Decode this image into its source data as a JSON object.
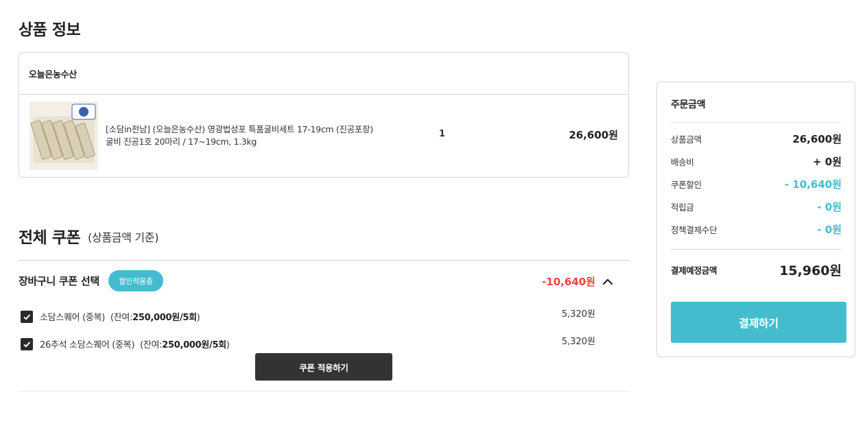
{
  "product_section": {
    "title": "상품 정보",
    "seller": "오늘은농수산",
    "item": {
      "name_line1": "[소담in전남] (오늘은농수산) 영광법성포 특품굴비세트 17-19cm (진공포장)",
      "name_line2": "굴비 진공1호 20마리 / 17~19cm, 1.3kg",
      "quantity": "1",
      "price": "26,600원"
    }
  },
  "coupon_section": {
    "title": "전체 쿠폰",
    "basis": "(상품금액 기준)",
    "cart_coupon_label": "장바구니 쿠폰 선택",
    "applied_badge": "할인적용중",
    "total_discount": "-10,640원",
    "coupons": [
      {
        "name": "소담스퀘어 (중복)",
        "remain_prefix": "(잔여:",
        "remain_value": "250,000원/5회",
        "remain_suffix": ")",
        "amount": "5,320원",
        "checked": true
      },
      {
        "name": "26추석 소담스퀘어 (중복)",
        "remain_prefix": "(잔여:",
        "remain_value": "250,000원/5회",
        "remain_suffix": ")",
        "amount": "5,320원",
        "checked": true
      }
    ],
    "apply_button": "쿠폰 적용하기"
  },
  "order_summary": {
    "title": "주문금액",
    "rows": [
      {
        "label": "상품금액",
        "value": "26,600원"
      },
      {
        "label": "배송비",
        "value": "+ 0원"
      },
      {
        "label": "쿠폰할인",
        "value": "- 10,640원"
      },
      {
        "label": "적립금",
        "value": "- 0원"
      },
      {
        "label": "정책결제수단",
        "value": "- 0원"
      }
    ],
    "total_label": "결제예정금액",
    "total_value": "15,960원",
    "pay_button": "결제하기"
  },
  "colors": {
    "accent_teal": "#45bccd",
    "discount_red": "#e8453c",
    "dark_button": "#333333"
  }
}
